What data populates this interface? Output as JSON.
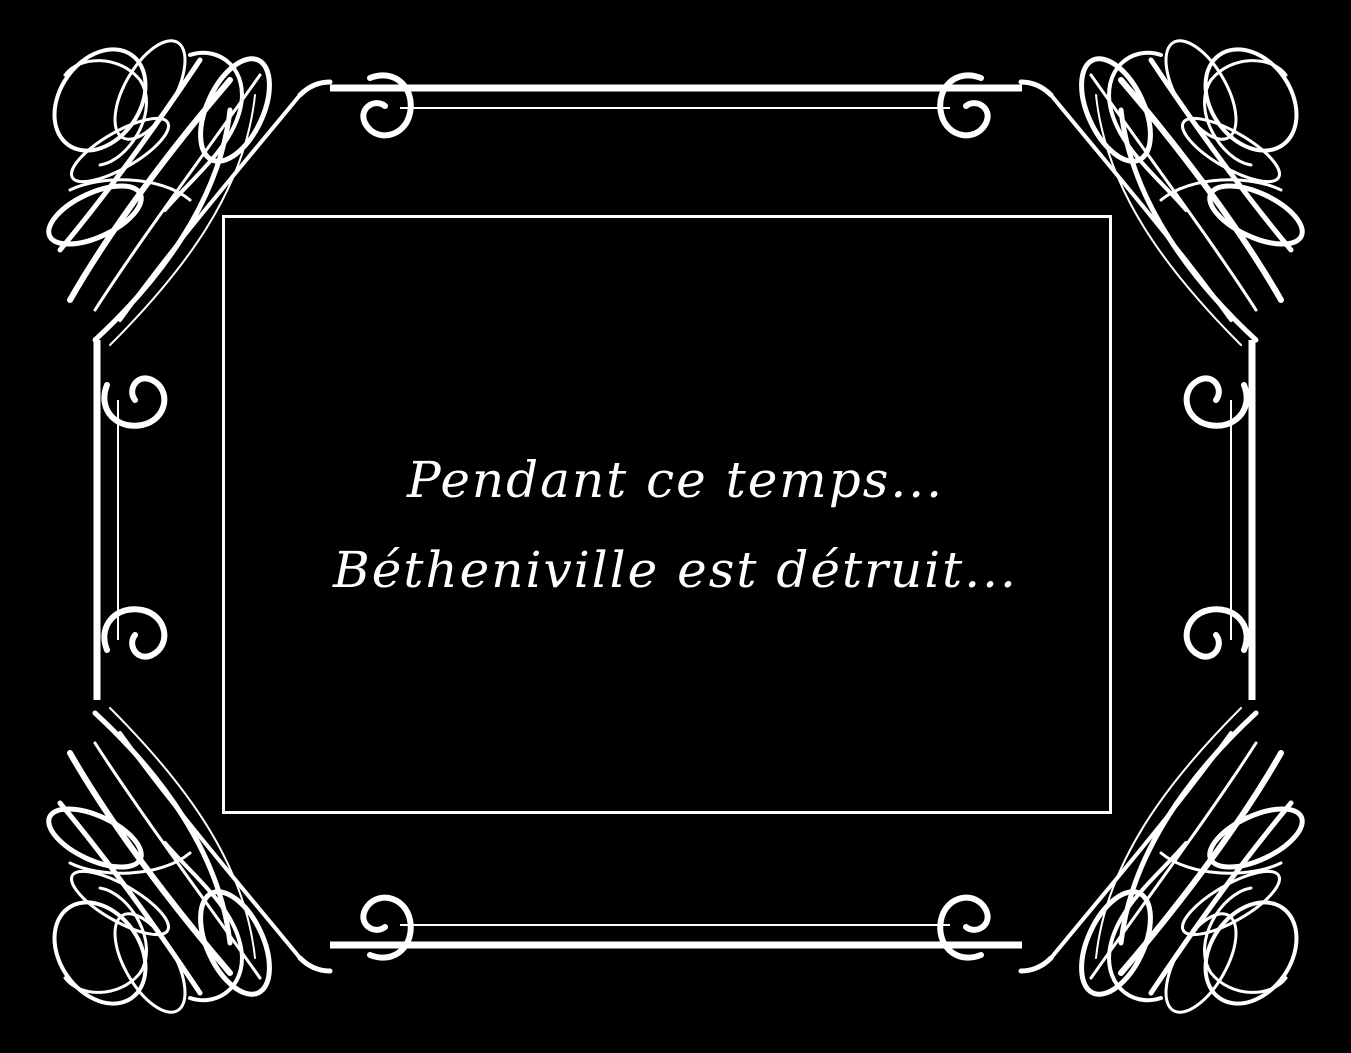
{
  "title_card": {
    "line1": "Pendant ce temps...",
    "line2": "Bétheniville est détruit..."
  },
  "colors": {
    "background": "#000000",
    "foreground": "#ffffff"
  },
  "icons": {
    "frame": "art-nouveau-ornamental-frame",
    "corner": "calligraphic-flourish-icon"
  }
}
